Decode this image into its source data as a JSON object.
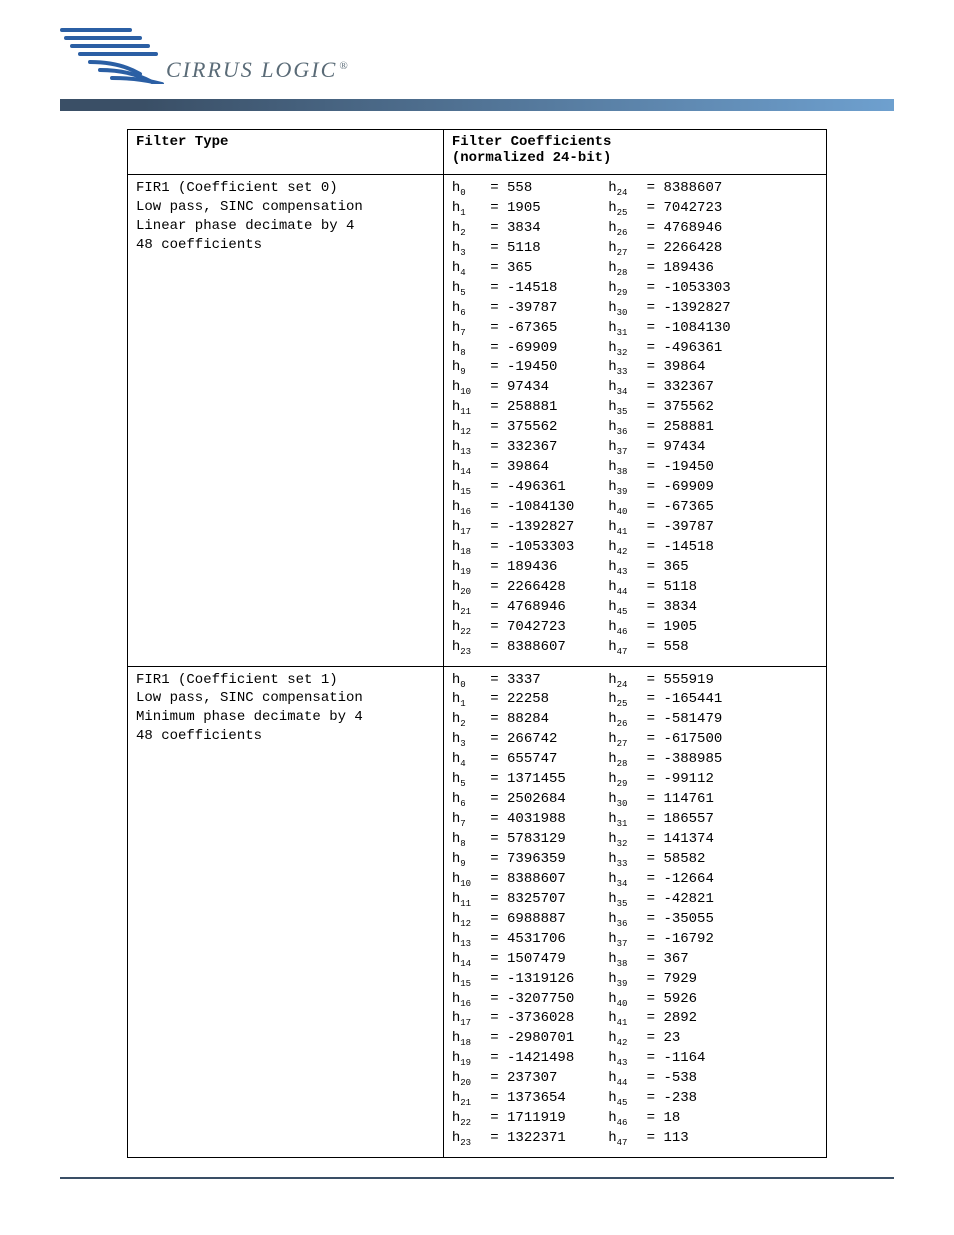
{
  "logo": {
    "brand_text": "CIRRUS LOGIC",
    "registered": "®"
  },
  "table": {
    "headers": {
      "filter_type": "Filter Type",
      "filter_coeffs_l1": "Filter Coefficients",
      "filter_coeffs_l2": "(normalized 24-bit)"
    },
    "sections": [
      {
        "type_lines": [
          "FIR1 (Coefficient set 0)",
          "Low pass, SINC compensation",
          "Linear phase decimate by 4",
          "48 coefficients"
        ],
        "coeffs": [
          {
            "i": 0,
            "v": "558"
          },
          {
            "i": 1,
            "v": "1905"
          },
          {
            "i": 2,
            "v": "3834"
          },
          {
            "i": 3,
            "v": "5118"
          },
          {
            "i": 4,
            "v": "365"
          },
          {
            "i": 5,
            "v": "-14518"
          },
          {
            "i": 6,
            "v": "-39787"
          },
          {
            "i": 7,
            "v": "-67365"
          },
          {
            "i": 8,
            "v": "-69909"
          },
          {
            "i": 9,
            "v": "-19450"
          },
          {
            "i": 10,
            "v": "97434"
          },
          {
            "i": 11,
            "v": "258881"
          },
          {
            "i": 12,
            "v": "375562"
          },
          {
            "i": 13,
            "v": "332367"
          },
          {
            "i": 14,
            "v": "39864"
          },
          {
            "i": 15,
            "v": "-496361"
          },
          {
            "i": 16,
            "v": "-1084130"
          },
          {
            "i": 17,
            "v": "-1392827"
          },
          {
            "i": 18,
            "v": "-1053303"
          },
          {
            "i": 19,
            "v": "189436"
          },
          {
            "i": 20,
            "v": "2266428"
          },
          {
            "i": 21,
            "v": "4768946"
          },
          {
            "i": 22,
            "v": "7042723"
          },
          {
            "i": 23,
            "v": "8388607"
          },
          {
            "i": 24,
            "v": "8388607"
          },
          {
            "i": 25,
            "v": "7042723"
          },
          {
            "i": 26,
            "v": "4768946"
          },
          {
            "i": 27,
            "v": "2266428"
          },
          {
            "i": 28,
            "v": "189436"
          },
          {
            "i": 29,
            "v": "-1053303"
          },
          {
            "i": 30,
            "v": "-1392827"
          },
          {
            "i": 31,
            "v": "-1084130"
          },
          {
            "i": 32,
            "v": "-496361"
          },
          {
            "i": 33,
            "v": "39864"
          },
          {
            "i": 34,
            "v": "332367"
          },
          {
            "i": 35,
            "v": "375562"
          },
          {
            "i": 36,
            "v": "258881"
          },
          {
            "i": 37,
            "v": "97434"
          },
          {
            "i": 38,
            "v": "-19450"
          },
          {
            "i": 39,
            "v": "-69909"
          },
          {
            "i": 40,
            "v": "-67365"
          },
          {
            "i": 41,
            "v": "-39787"
          },
          {
            "i": 42,
            "v": "-14518"
          },
          {
            "i": 43,
            "v": "365"
          },
          {
            "i": 44,
            "v": "5118"
          },
          {
            "i": 45,
            "v": "3834"
          },
          {
            "i": 46,
            "v": "1905"
          },
          {
            "i": 47,
            "v": "558"
          }
        ]
      },
      {
        "type_lines": [
          "FIR1 (Coefficient set 1)",
          "Low pass, SINC compensation",
          "Minimum phase decimate by 4",
          "48 coefficients"
        ],
        "coeffs": [
          {
            "i": 0,
            "v": "3337"
          },
          {
            "i": 1,
            "v": "22258"
          },
          {
            "i": 2,
            "v": "88284"
          },
          {
            "i": 3,
            "v": "266742"
          },
          {
            "i": 4,
            "v": "655747"
          },
          {
            "i": 5,
            "v": "1371455"
          },
          {
            "i": 6,
            "v": "2502684"
          },
          {
            "i": 7,
            "v": "4031988"
          },
          {
            "i": 8,
            "v": "5783129"
          },
          {
            "i": 9,
            "v": "7396359"
          },
          {
            "i": 10,
            "v": "8388607"
          },
          {
            "i": 11,
            "v": "8325707"
          },
          {
            "i": 12,
            "v": "6988887"
          },
          {
            "i": 13,
            "v": "4531706"
          },
          {
            "i": 14,
            "v": "1507479"
          },
          {
            "i": 15,
            "v": "-1319126"
          },
          {
            "i": 16,
            "v": "-3207750"
          },
          {
            "i": 17,
            "v": "-3736028"
          },
          {
            "i": 18,
            "v": "-2980701"
          },
          {
            "i": 19,
            "v": "-1421498"
          },
          {
            "i": 20,
            "v": "237307"
          },
          {
            "i": 21,
            "v": "1373654"
          },
          {
            "i": 22,
            "v": "1711919"
          },
          {
            "i": 23,
            "v": "1322371"
          },
          {
            "i": 24,
            "v": "555919"
          },
          {
            "i": 25,
            "v": "-165441"
          },
          {
            "i": 26,
            "v": "-581479"
          },
          {
            "i": 27,
            "v": "-617500"
          },
          {
            "i": 28,
            "v": "-388985"
          },
          {
            "i": 29,
            "v": "-99112"
          },
          {
            "i": 30,
            "v": "114761"
          },
          {
            "i": 31,
            "v": "186557"
          },
          {
            "i": 32,
            "v": "141374"
          },
          {
            "i": 33,
            "v": "58582"
          },
          {
            "i": 34,
            "v": "-12664"
          },
          {
            "i": 35,
            "v": "-42821"
          },
          {
            "i": 36,
            "v": "-35055"
          },
          {
            "i": 37,
            "v": "-16792"
          },
          {
            "i": 38,
            "v": "367"
          },
          {
            "i": 39,
            "v": "7929"
          },
          {
            "i": 40,
            "v": "5926"
          },
          {
            "i": 41,
            "v": "2892"
          },
          {
            "i": 42,
            "v": "23"
          },
          {
            "i": 43,
            "v": "-1164"
          },
          {
            "i": 44,
            "v": "-538"
          },
          {
            "i": 45,
            "v": "-238"
          },
          {
            "i": 46,
            "v": "18"
          },
          {
            "i": 47,
            "v": "113"
          }
        ]
      }
    ]
  }
}
